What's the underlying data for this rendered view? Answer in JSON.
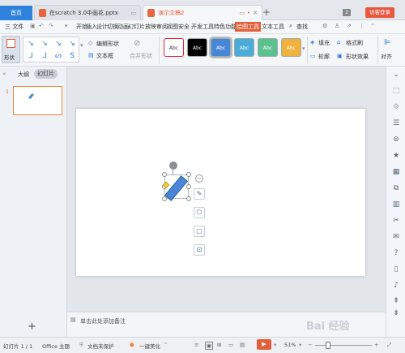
{
  "tabs": {
    "home": "首页",
    "file1": "在scratch 3.0中画花.pptx",
    "file2": "演示文稿2",
    "plus": "+",
    "badge": "2",
    "login": "访客登录"
  },
  "menu": {
    "file": "三 文件",
    "items": [
      "开始",
      "插入",
      "设计",
      "切换",
      "动画",
      "幻灯片放映",
      "审阅",
      "视图",
      "安全",
      "开发工具",
      "特色功能",
      "绘图工具",
      "文本工具"
    ],
    "search": "查找"
  },
  "ribbon": {
    "shape": "形状",
    "edit_shape": "编辑形状",
    "text_box": "文本框",
    "merge_shape": "合并形状",
    "style_sample": "Abc",
    "fill": "填充",
    "format_brush": "格式刷",
    "outline": "轮廓",
    "shape_effect": "形状效果",
    "align": "对齐"
  },
  "colors": {
    "accent": "#e15f3b",
    "style_boxes": [
      "#ffffff",
      "#000000",
      "#4a86d8",
      "#4bacd8",
      "#5cc08f",
      "#f0b23c"
    ],
    "shape_fill": "#4a86d8"
  },
  "left_panel": {
    "tab_outline": "大纲",
    "tab_slides": "幻灯片",
    "slide_number": "1",
    "add_icon": "+"
  },
  "notes": {
    "placeholder": "单击此处添加备注"
  },
  "status": {
    "slide_info": "幻灯片 1 / 1",
    "theme": "Office 主题",
    "protect": "文档未保护",
    "beautify": "一键美化",
    "zoom": "51%"
  },
  "watermark": "Bai 经验"
}
